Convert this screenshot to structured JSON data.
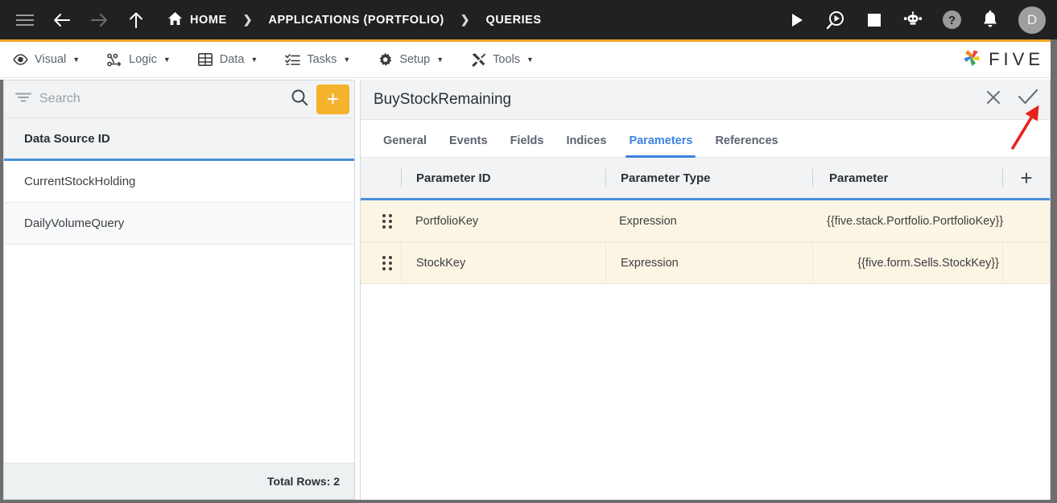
{
  "topbar": {
    "menu_icon": "hamburger-icon",
    "back_icon": "arrow-left-icon",
    "forward_icon": "arrow-right-icon",
    "up_icon": "arrow-up-icon",
    "breadcrumbs": [
      {
        "label": "HOME",
        "icon": "home-icon"
      },
      {
        "label": "APPLICATIONS (PORTFOLIO)",
        "icon": ""
      },
      {
        "label": "QUERIES",
        "icon": ""
      }
    ],
    "separator": "❯",
    "actions": [
      {
        "name": "run-button",
        "icon": "play-icon"
      },
      {
        "name": "debug-button",
        "icon": "search-play-icon"
      },
      {
        "name": "stop-button",
        "icon": "stop-square-icon"
      },
      {
        "name": "assistant-button",
        "icon": "robot-icon"
      },
      {
        "name": "help-button",
        "icon": "question-circle-icon"
      },
      {
        "name": "notifications-button",
        "icon": "bell-icon"
      }
    ],
    "avatar_initial": "D"
  },
  "menubar": {
    "items": [
      {
        "label": "Visual",
        "icon": "eye-icon",
        "caret": "▼"
      },
      {
        "label": "Logic",
        "icon": "flow-nodes-icon",
        "caret": "▼"
      },
      {
        "label": "Data",
        "icon": "table-grid-icon",
        "caret": "▼"
      },
      {
        "label": "Tasks",
        "icon": "checklist-icon",
        "caret": "▼"
      },
      {
        "label": "Setup",
        "icon": "gear-icon",
        "caret": "▼"
      },
      {
        "label": "Tools",
        "icon": "tools-icon",
        "caret": "▼"
      }
    ],
    "brand": {
      "name": "five-logo",
      "word": "FIVE"
    }
  },
  "sidebar": {
    "search": {
      "placeholder": "Search",
      "value": "",
      "filter_icon": "filter-icon",
      "search_icon": "magnifier-icon"
    },
    "add_button_label": "+",
    "column_header": "Data Source ID",
    "rows": [
      {
        "label": "CurrentStockHolding"
      },
      {
        "label": "DailyVolumeQuery"
      }
    ],
    "footer": "Total Rows: 2"
  },
  "detail": {
    "title": "BuyStockRemaining",
    "close_icon": "close-x-icon",
    "confirm_icon": "checkmark-icon",
    "tabs": [
      {
        "label": "General",
        "active": false
      },
      {
        "label": "Events",
        "active": false
      },
      {
        "label": "Fields",
        "active": false
      },
      {
        "label": "Indices",
        "active": false
      },
      {
        "label": "Parameters",
        "active": true
      },
      {
        "label": "References",
        "active": false
      }
    ],
    "table": {
      "columns": [
        "Parameter ID",
        "Parameter Type",
        "Parameter"
      ],
      "add_label": "+",
      "rows": [
        {
          "id": "PortfolioKey",
          "type": "Expression",
          "parameter": "{{five.stack.Portfolio.PortfolioKey}}"
        },
        {
          "id": "StockKey",
          "type": "Expression",
          "parameter": "{{five.form.Sells.StockKey}}"
        }
      ]
    }
  },
  "annotation": {
    "name": "red-arrow-to-confirm",
    "color": "#E8211B"
  },
  "colors": {
    "accent_orange": "#F5B22D",
    "accent_blue": "#3b82e0",
    "row_highlight": "#fdf5e3",
    "topbar_bg": "#212121"
  }
}
